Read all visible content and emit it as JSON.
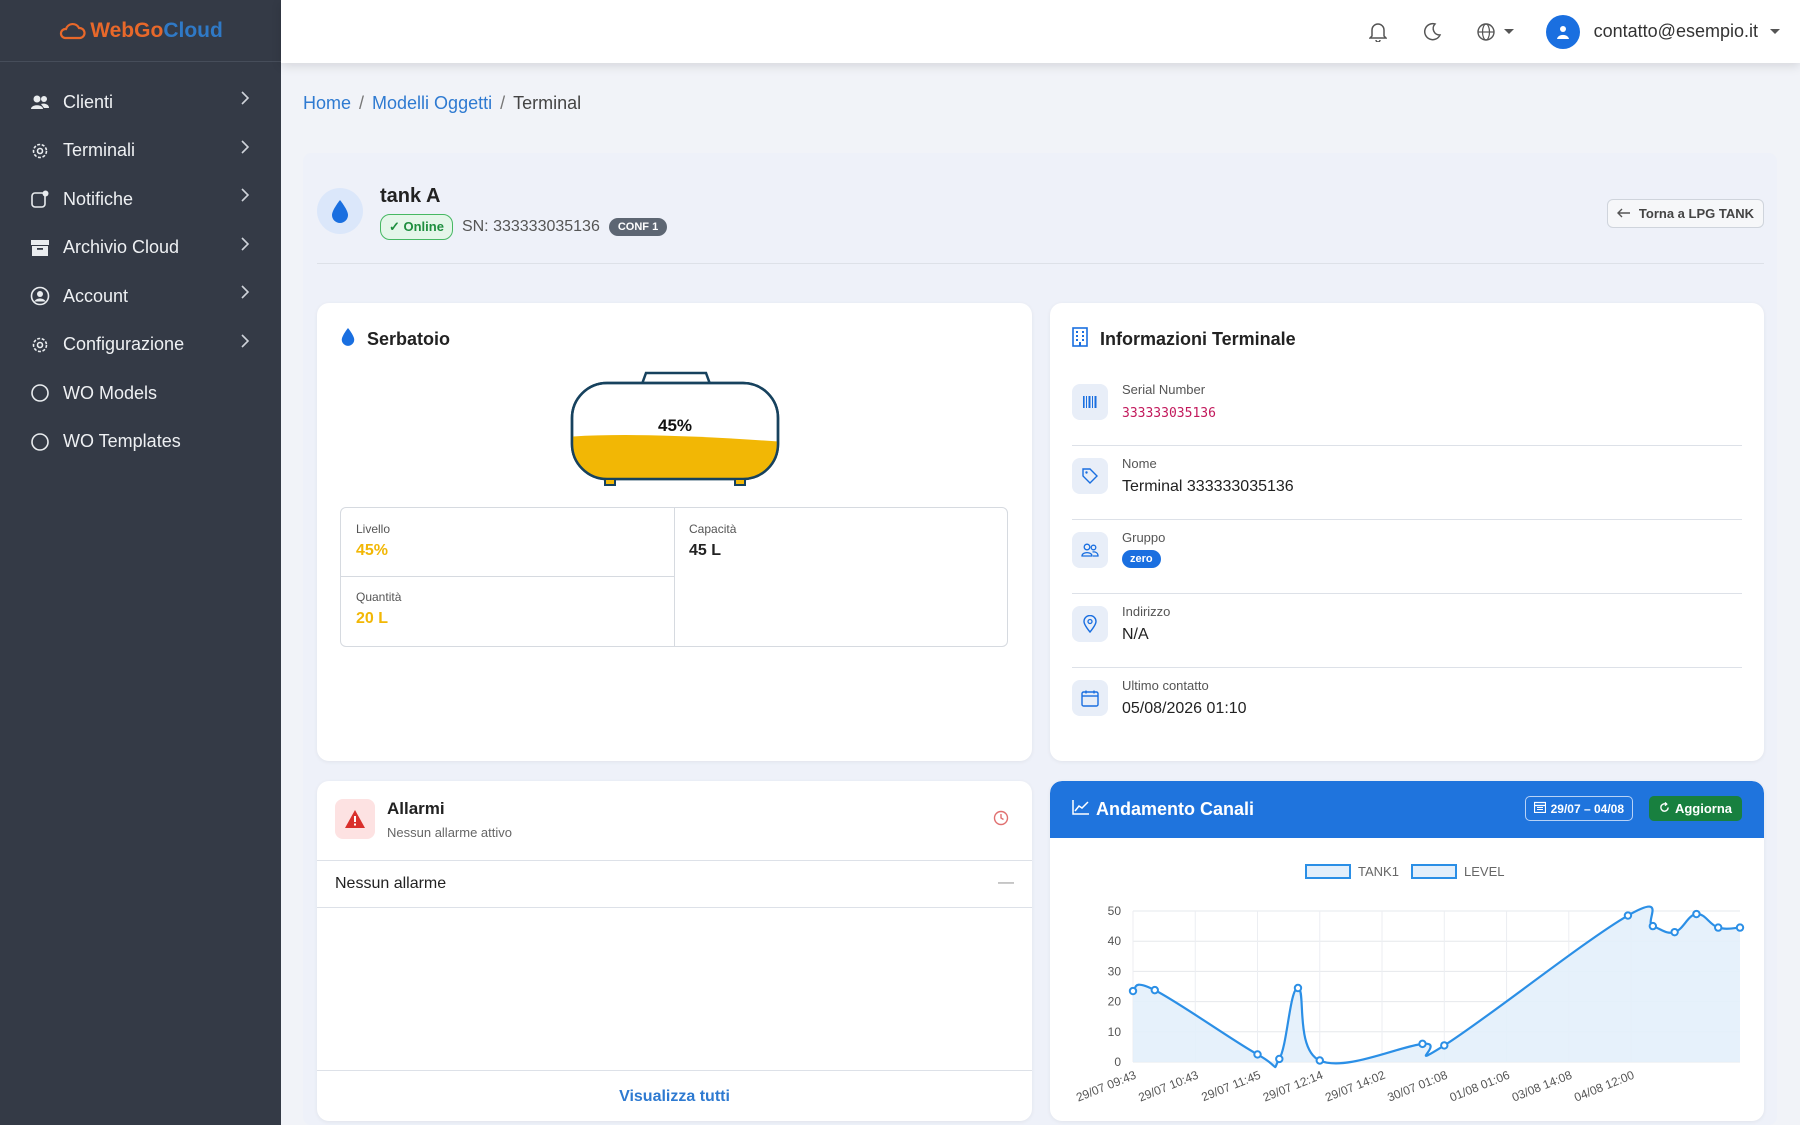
{
  "logo": {
    "part1": "WebGo",
    "part2": "Cloud"
  },
  "sidebar": {
    "items": [
      {
        "label": "Clienti",
        "icon": "users-icon",
        "has_children": true
      },
      {
        "label": "Terminali",
        "icon": "gear-icon",
        "has_children": true
      },
      {
        "label": "Notifiche",
        "icon": "notification-icon",
        "has_children": true
      },
      {
        "label": "Archivio Cloud",
        "icon": "archive-icon",
        "has_children": true
      },
      {
        "label": "Account",
        "icon": "user-circle-icon",
        "has_children": true
      },
      {
        "label": "Configurazione",
        "icon": "gear-icon",
        "has_children": true
      },
      {
        "label": "WO Models",
        "icon": "circle-icon",
        "has_children": false
      },
      {
        "label": "WO Templates",
        "icon": "circle-icon",
        "has_children": false
      }
    ]
  },
  "topbar": {
    "user_email": "contatto@esempio.it"
  },
  "breadcrumb": {
    "home": "Home",
    "models": "Modelli Oggetti",
    "current": "Terminal"
  },
  "terminal": {
    "name": "tank A",
    "status": "✓ Online",
    "sn_text": "SN: 333333035136",
    "conf_badge": "CONF 1",
    "back_label": "Torna a LPG TANK"
  },
  "tank_card": {
    "title": "Serbatoio",
    "fill_percent_label": "45%",
    "fill_fraction": 0.45,
    "level_label": "Livello",
    "level_value": "45%",
    "capacity_label": "Capacità",
    "capacity_value": "45 L",
    "quantity_label": "Quantità",
    "quantity_value": "20 L"
  },
  "info_card": {
    "title": "Informazioni Terminale",
    "rows": [
      {
        "label": "Serial Number",
        "value": "333333035136",
        "icon": "barcode-icon"
      },
      {
        "label": "Nome",
        "value": "Terminal 333333035136",
        "icon": "tag-icon"
      },
      {
        "label": "Gruppo",
        "value": "zero",
        "icon": "group-icon"
      },
      {
        "label": "Indirizzo",
        "value": "N/A",
        "icon": "location-icon"
      },
      {
        "label": "Ultimo contatto",
        "value": "05/08/2026 01:10",
        "icon": "calendar-icon"
      }
    ]
  },
  "alarms": {
    "title": "Allarmi",
    "subtitle": "Nessun allarme attivo",
    "row_text": "Nessun allarme",
    "row_dash": "—",
    "view_all": "Visualizza tutti"
  },
  "chart_panel": {
    "title": "Andamento Canali",
    "date_range": "29/07 – 04/08",
    "refresh": "Aggiorna"
  },
  "chart_data": {
    "type": "line",
    "legend_position": "top",
    "grid": true,
    "ylim": [
      0,
      50
    ],
    "yticks": [
      0,
      10,
      20,
      30,
      40,
      50
    ],
    "tick_labels": [
      "29/07 09:43",
      "29/07 10:43",
      "29/07 11:45",
      "29/07 12:14",
      "29/07 14:02",
      "30/07 01:08",
      "01/08 01:06",
      "03/08 14:08",
      "04/08 12:00"
    ],
    "series": [
      {
        "name": "TANK1",
        "color": "#2b8fe6",
        "points": [
          [
            0,
            23.5
          ],
          [
            0.35,
            23.8
          ],
          [
            2.0,
            2.5
          ],
          [
            2.35,
            1
          ],
          [
            2.65,
            24.5
          ],
          [
            3.0,
            0.5
          ],
          [
            4.65,
            6
          ],
          [
            5.0,
            5.5
          ],
          [
            7.95,
            48.5
          ],
          [
            8.35,
            45
          ],
          [
            8.7,
            43
          ],
          [
            9.05,
            49
          ],
          [
            9.4,
            44.5
          ],
          [
            9.75,
            44.5
          ]
        ]
      },
      {
        "name": "LEVEL",
        "color": "#2b8fe6",
        "points": []
      }
    ]
  },
  "colors": {
    "sidebar": "#343a46",
    "primary": "#1f74dd",
    "tank_fill": "#f2b705",
    "success": "#18803f"
  }
}
